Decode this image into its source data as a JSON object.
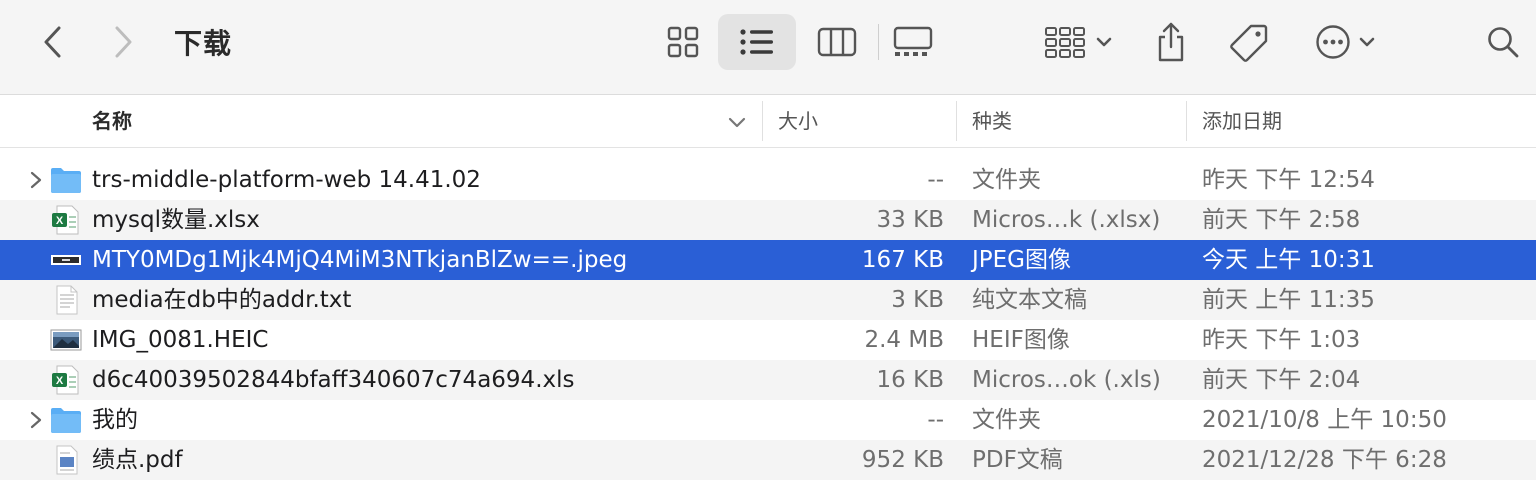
{
  "window": {
    "title": "下载"
  },
  "toolbar": {
    "back_icon": "chevron-left-icon",
    "forward_icon": "chevron-right-icon",
    "view_modes": [
      "icon-view",
      "list-view",
      "column-view",
      "gallery-view"
    ],
    "active_view": "list-view",
    "group_icon": "group-by-icon",
    "share_icon": "share-icon",
    "tag_icon": "tag-icon",
    "more_icon": "ellipsis-circle-icon",
    "search_icon": "search-icon"
  },
  "columns": {
    "name": "名称",
    "size": "大小",
    "kind": "种类",
    "date_added": "添加日期"
  },
  "files": [
    {
      "name": "trs-middle-platform-web 14.41.02",
      "size": "--",
      "kind": "文件夹",
      "date": "昨天 下午 12:54",
      "icon": "folder-icon",
      "expandable": true
    },
    {
      "name": "mysql数量.xlsx",
      "size": "33 KB",
      "kind": "Micros…k (.xlsx)",
      "date": "前天 下午 2:58",
      "icon": "excel-file-icon",
      "expandable": false
    },
    {
      "name": "MTY0MDg1Mjk4MjQ4MiM3NTkjanBlZw==.jpeg",
      "size": "167 KB",
      "kind": "JPEG图像",
      "date": "今天 上午 10:31",
      "icon": "jpeg-thumbnail-icon",
      "expandable": false,
      "selected": true
    },
    {
      "name": "media在db中的addr.txt",
      "size": "3 KB",
      "kind": "纯文本文稿",
      "date": "前天 上午 11:35",
      "icon": "text-file-icon",
      "expandable": false
    },
    {
      "name": "IMG_0081.HEIC",
      "size": "2.4 MB",
      "kind": "HEIF图像",
      "date": "昨天 下午 1:03",
      "icon": "image-thumbnail-icon",
      "expandable": false
    },
    {
      "name": "d6c40039502844bfaff340607c74a694.xls",
      "size": "16 KB",
      "kind": "Micros…ok (.xls)",
      "date": "前天 下午 2:04",
      "icon": "excel-file-icon",
      "expandable": false
    },
    {
      "name": "我的",
      "size": "--",
      "kind": "文件夹",
      "date": "2021/10/8 上午 10:50",
      "icon": "folder-icon",
      "expandable": true
    },
    {
      "name": "绩点.pdf",
      "size": "952 KB",
      "kind": "PDF文稿",
      "date": "2021/12/28 下午 6:28",
      "icon": "pdf-file-icon",
      "expandable": false
    }
  ],
  "colors": {
    "selection": "#2a5fd6",
    "folder": "#5aaef5",
    "excel": "#1d7a42",
    "toolbar_bg": "#f5f5f5"
  }
}
